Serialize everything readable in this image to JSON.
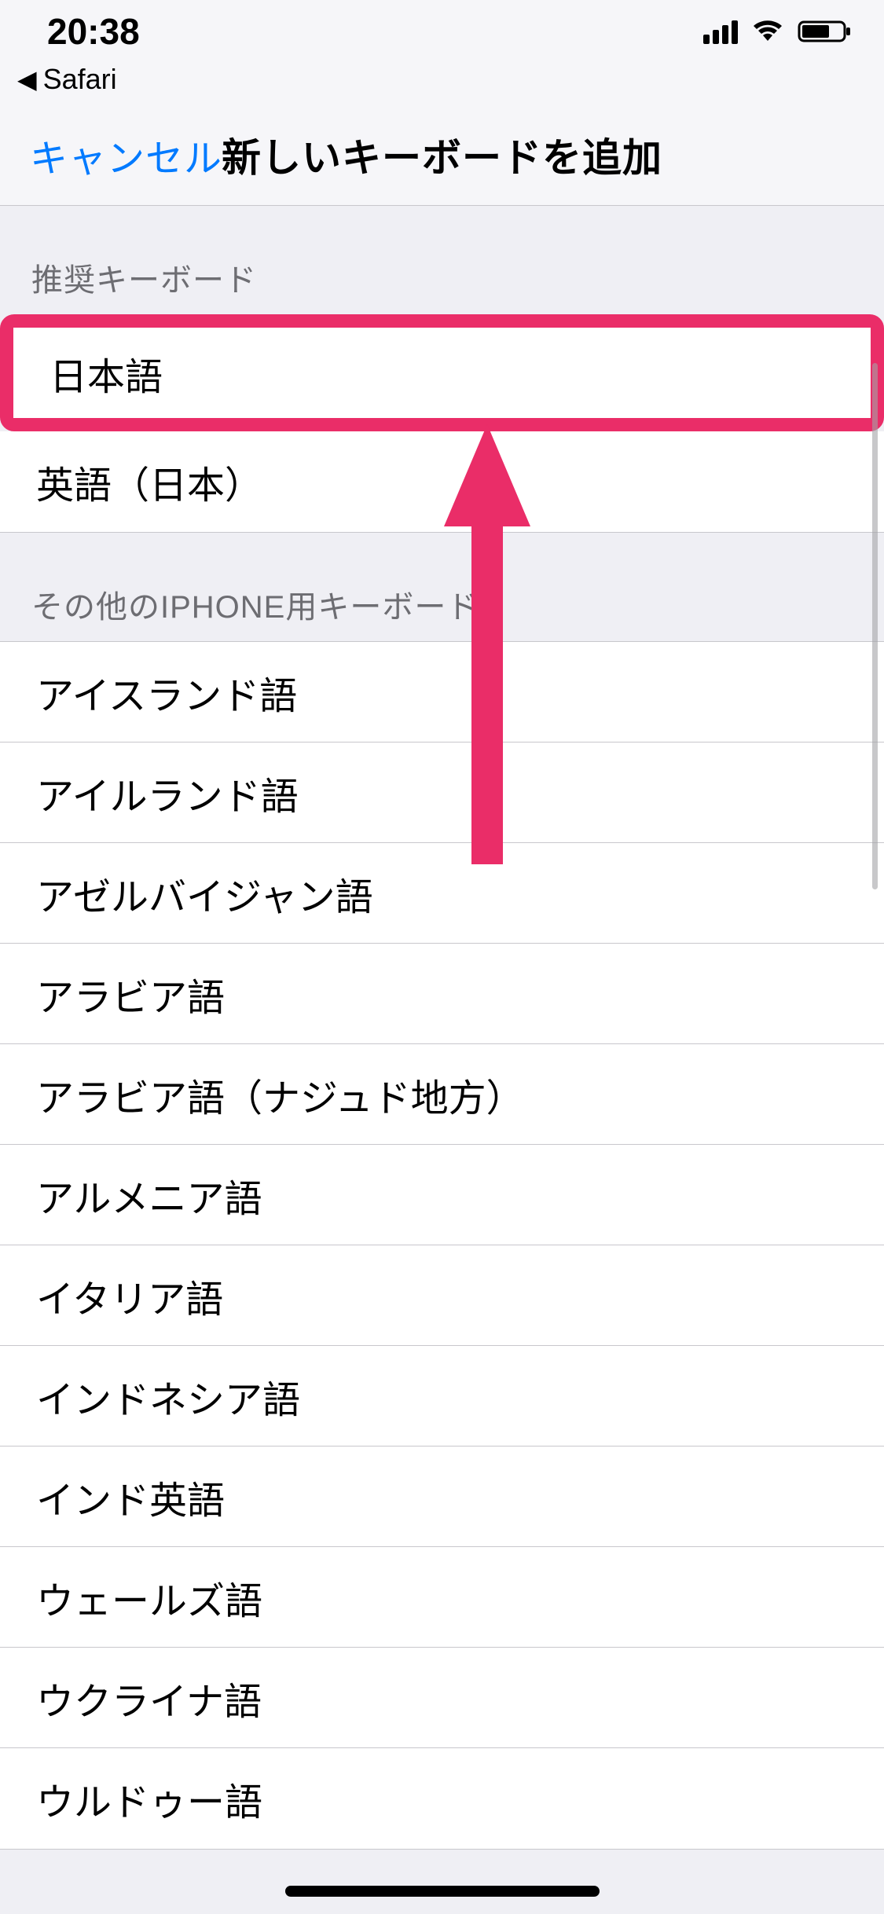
{
  "status": {
    "time": "20:38",
    "back_app": "Safari"
  },
  "nav": {
    "cancel": "キャンセル",
    "title": "新しいキーボードを追加"
  },
  "sections": {
    "recommended_header": "推奨キーボード",
    "recommended": [
      "日本語",
      "英語（日本）"
    ],
    "other_header": "その他のIPHONE用キーボード",
    "other": [
      "アイスランド語",
      "アイルランド語",
      "アゼルバイジャン語",
      "アラビア語",
      "アラビア語（ナジュド地方）",
      "アルメニア語",
      "イタリア語",
      "インドネシア語",
      "インド英語",
      "ウェールズ語",
      "ウクライナ語",
      "ウルドゥー語"
    ]
  },
  "annotation": {
    "highlight_index": 0,
    "arrow_color": "#ea2d68"
  }
}
